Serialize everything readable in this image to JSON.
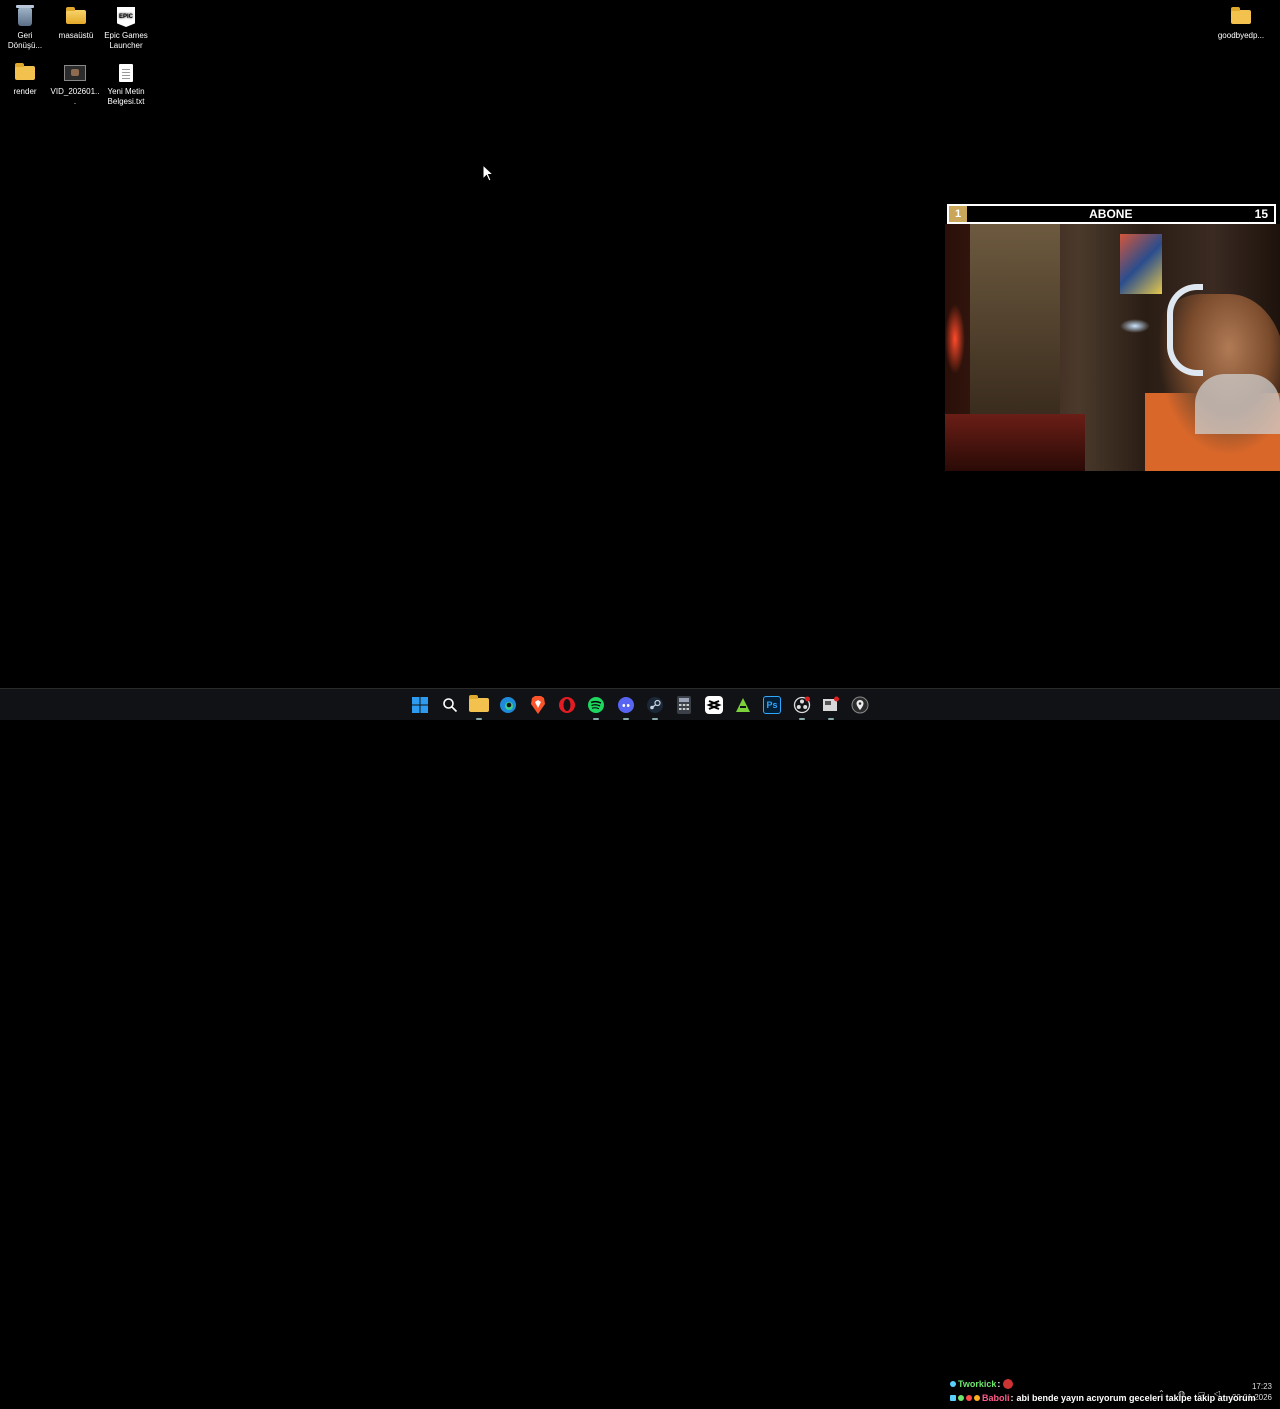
{
  "desktop": {
    "icons": [
      {
        "id": "recycle",
        "label": "Geri Dönüşü...",
        "icon": "recycle-bin-icon"
      },
      {
        "id": "masaustu",
        "label": "masaüstü",
        "icon": "folder-icon"
      },
      {
        "id": "epic",
        "label": "Epic Games Launcher",
        "icon": "epic-games-icon",
        "glyph_text": "EPIC"
      },
      {
        "id": "render",
        "label": "render",
        "icon": "folder-icon"
      },
      {
        "id": "video",
        "label": "VID_202601...",
        "icon": "video-file-icon"
      },
      {
        "id": "txt",
        "label": "Yeni Metin Belgesi.txt",
        "icon": "text-file-icon"
      },
      {
        "id": "goodbye",
        "label": "goodbyedp...",
        "icon": "folder-icon"
      }
    ]
  },
  "overlay": {
    "sub_goal": {
      "start": "1",
      "label": "ABONE",
      "end": "15"
    },
    "chat": [
      {
        "name": "Tworkick",
        "separator": ":",
        "message": ""
      },
      {
        "name": "Baboli",
        "separator": ":",
        "message": "abi bende yayın acıyorum geceleri takipe takip atıyorum"
      }
    ]
  },
  "taskbar": {
    "apps": [
      {
        "name": "start-button",
        "icon": "windows-icon"
      },
      {
        "name": "search-button",
        "icon": "search-icon"
      },
      {
        "name": "file-explorer",
        "icon": "folder-icon"
      },
      {
        "name": "edge",
        "icon": "edge-icon"
      },
      {
        "name": "brave",
        "icon": "brave-icon"
      },
      {
        "name": "opera",
        "icon": "opera-icon"
      },
      {
        "name": "spotify",
        "icon": "spotify-icon"
      },
      {
        "name": "discord",
        "icon": "discord-icon"
      },
      {
        "name": "steam",
        "icon": "steam-icon"
      },
      {
        "name": "calculator",
        "icon": "calculator-icon"
      },
      {
        "name": "capcut",
        "icon": "capcut-icon"
      },
      {
        "name": "app-green",
        "icon": "green-app-icon"
      },
      {
        "name": "photoshop",
        "icon": "photoshop-icon",
        "text": "Ps"
      },
      {
        "name": "app-obs",
        "icon": "obs-icon"
      },
      {
        "name": "app-snip",
        "icon": "snipping-icon"
      },
      {
        "name": "app-location",
        "icon": "location-icon"
      }
    ],
    "clock": {
      "time": "17:23",
      "date": "20.01.2026"
    }
  },
  "colors": {
    "background": "#000000",
    "taskbar": "#111216",
    "sub_goal_accent": "#c9a65a"
  }
}
